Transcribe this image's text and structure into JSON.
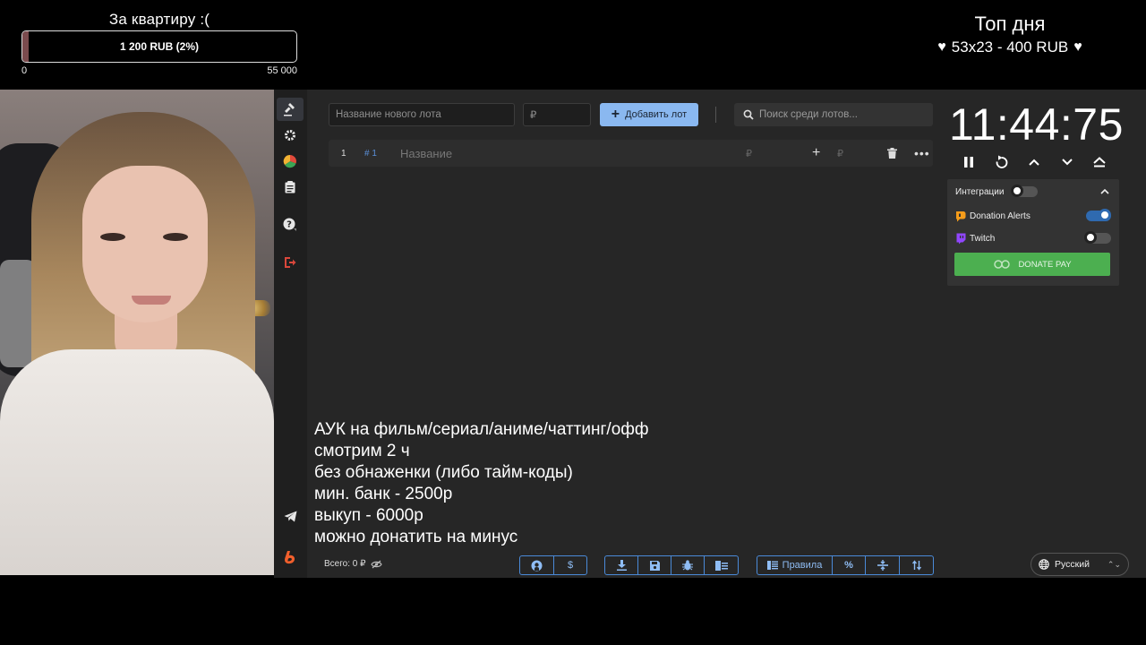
{
  "goal": {
    "title": "За квартиру :(",
    "progress_text": "1 200 RUB (2%)",
    "progress_fraction": 0.022,
    "min_label": "0",
    "max_label": "55 000",
    "fill_color": "#7b4b4e"
  },
  "top_day": {
    "title": "Топ дня",
    "entry": "53x23 - 400 RUB",
    "icon": "heart-icon"
  },
  "sidebar": {
    "items": [
      {
        "icon": "gavel-icon",
        "active": true
      },
      {
        "icon": "gear-icon",
        "active": false
      },
      {
        "icon": "wheel-icon",
        "active": false
      },
      {
        "icon": "clipboard-icon",
        "active": false
      },
      {
        "icon": "help-icon",
        "active": false
      },
      {
        "icon": "logout-icon",
        "active": false
      },
      {
        "icon": "telegram-icon",
        "active": false
      },
      {
        "icon": "boosty-icon",
        "active": false
      }
    ]
  },
  "toolbar": {
    "lot_name_placeholder": "Название нового лота",
    "amount_placeholder": "₽",
    "add_button_label": "Добавить лот",
    "search_placeholder": "Поиск среди лотов..."
  },
  "lots": [
    {
      "number": "1",
      "id": "# 1",
      "name_placeholder": "Название",
      "currency": "₽",
      "add_currency": "₽"
    }
  ],
  "timer": {
    "display": "11:44:75"
  },
  "integrations": {
    "title": "Интеграции",
    "master_enabled": false,
    "items": [
      {
        "label": "Donation Alerts",
        "enabled": true,
        "icon": "donation-alerts-icon",
        "color": "#f59c1a"
      },
      {
        "label": "Twitch",
        "enabled": false,
        "icon": "twitch-icon",
        "color": "#9146ff"
      }
    ],
    "donate_button_label": "DONATE PAY"
  },
  "rules_text": [
    "АУК на фильм/сериал/аниме/чаттинг/офф",
    "смотрим 2 ч",
    "без обнаженки (либо тайм-коды)",
    "мин. банк - 2500р",
    "выкуп - 6000р",
    "можно донатить на минус"
  ],
  "footer": {
    "total_label": "Всего: 0 ₽",
    "rules_button_label": "Правила",
    "language": "Русский"
  },
  "colors": {
    "accent_blue": "#8ab8f0",
    "donate_green": "#4caf50",
    "app_bg": "#262626"
  }
}
